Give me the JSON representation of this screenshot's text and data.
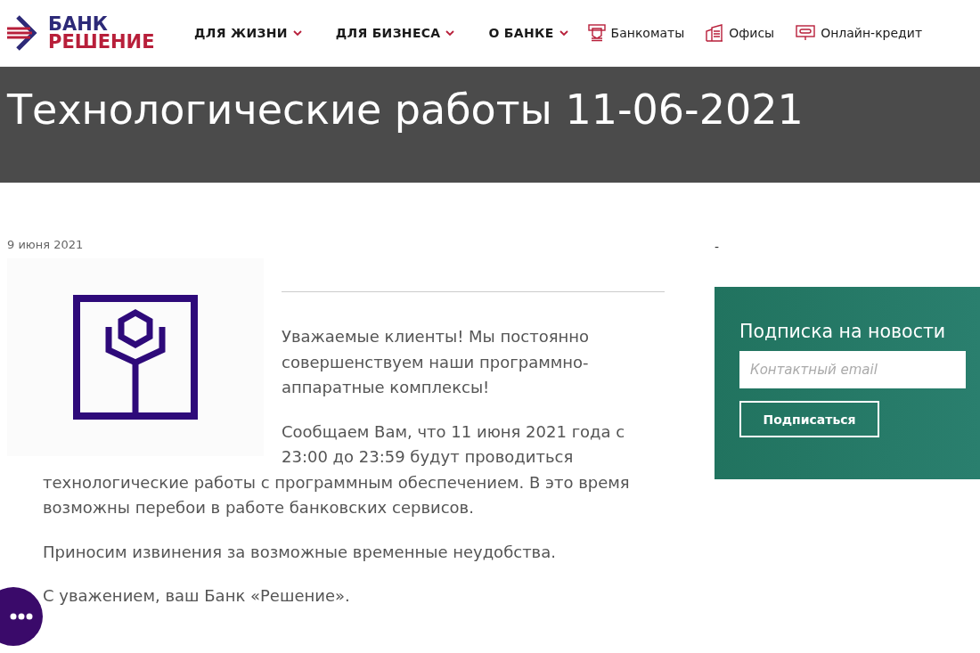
{
  "header": {
    "logo": {
      "line_1": "БАНК",
      "line_2": "РЕШЕНИЕ"
    },
    "menus": [
      {
        "label": "ДЛЯ ЖИЗНИ"
      },
      {
        "label": "ДЛЯ БИЗНЕСА"
      },
      {
        "label": "О БАНКЕ"
      }
    ],
    "links": [
      {
        "kind": "atm",
        "label": "Банкоматы"
      },
      {
        "kind": "office",
        "label": "Офисы"
      },
      {
        "kind": "credit",
        "label": "Онлайн-кредит"
      }
    ]
  },
  "banner": {
    "title": "Технологические работы 11-06-2021"
  },
  "article": {
    "date": "9 июня 2021",
    "paragraphs": [
      "Уважаемые клиенты! Мы постоянно совершенствуем наши программно-аппаратные комплексы!",
      "Сообщаем Вам, что 11 июня 2021 года с 23:00 до 23:59 будут проводиться технологические работы с программным обеспечением. В это время возможны перебои в работе банковских сервисов.",
      "Приносим извинения за возможные временные неудобства.",
      "С уважением, ваш Банк «Решение»."
    ]
  },
  "sidebar": {
    "dash": "-",
    "subscribe": {
      "title": "Подписка на новости",
      "placeholder": "Контактный email",
      "button": "Подписаться"
    }
  }
}
